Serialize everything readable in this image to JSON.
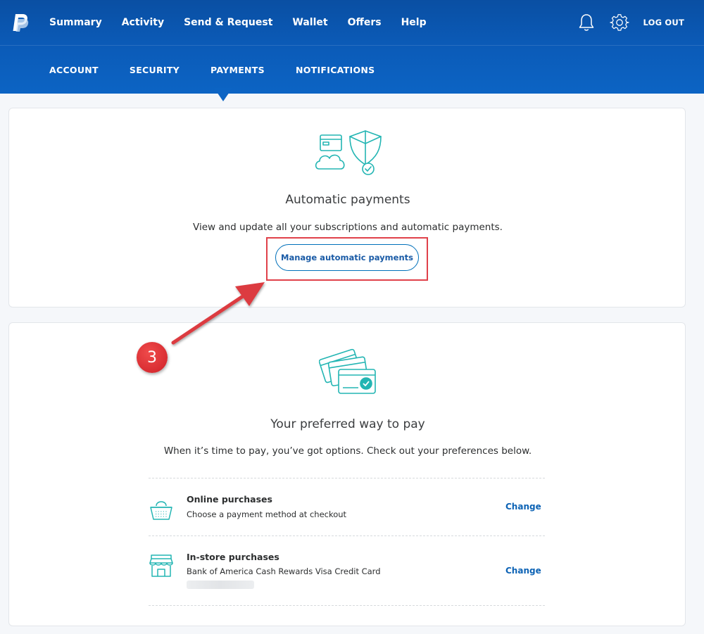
{
  "nav": {
    "items": [
      "Summary",
      "Activity",
      "Send & Request",
      "Wallet",
      "Offers",
      "Help"
    ],
    "logout_label": "LOG OUT"
  },
  "subnav": {
    "items": [
      "ACCOUNT",
      "SECURITY",
      "PAYMENTS",
      "NOTIFICATIONS"
    ],
    "active": "PAYMENTS"
  },
  "auto_payments": {
    "title": "Automatic payments",
    "description": "View and update all your subscriptions and automatic payments.",
    "button_label": "Manage automatic payments",
    "icon": "cloud-shield-icon"
  },
  "preferred": {
    "title": "Your preferred way to pay",
    "description": "When it’s time to pay, you’ve got options. Check out your preferences below.",
    "icon": "credit-cards-icon",
    "rows": [
      {
        "title": "Online purchases",
        "subtitle": "Choose a payment method at checkout",
        "action": "Change",
        "icon": "shopping-basket-icon"
      },
      {
        "title": "In-store purchases",
        "subtitle": "Bank of America Cash Rewards Visa Credit Card",
        "action": "Change",
        "icon": "storefront-icon"
      }
    ]
  },
  "annotation": {
    "step_number": "3"
  },
  "colors": {
    "header_blue": "#0b5bb8",
    "accent_teal": "#23b5b3",
    "link_blue": "#0d63b5",
    "highlight_red": "#e0414a"
  }
}
